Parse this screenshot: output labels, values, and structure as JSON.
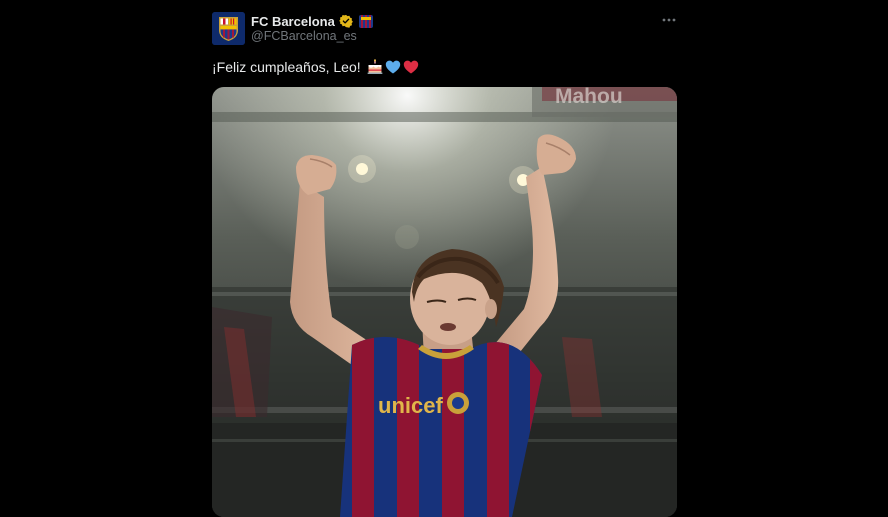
{
  "tweet": {
    "author_name": "FC Barcelona",
    "author_handle": "@FCBarcelona_es",
    "text": "¡Feliz cumpleaños, Leo!",
    "emojis": [
      "birthday-cake",
      "blue-heart",
      "red-heart"
    ],
    "stadium_sign_text": "Mahou",
    "shirt_sponsor_text": "unicef"
  },
  "colors": {
    "background": "#000000",
    "text_primary": "#e7e9ea",
    "text_secondary": "#71767b",
    "verified_gold": "#e2b719",
    "barca_blue": "#1b3a8c",
    "barca_red": "#a3173a"
  }
}
